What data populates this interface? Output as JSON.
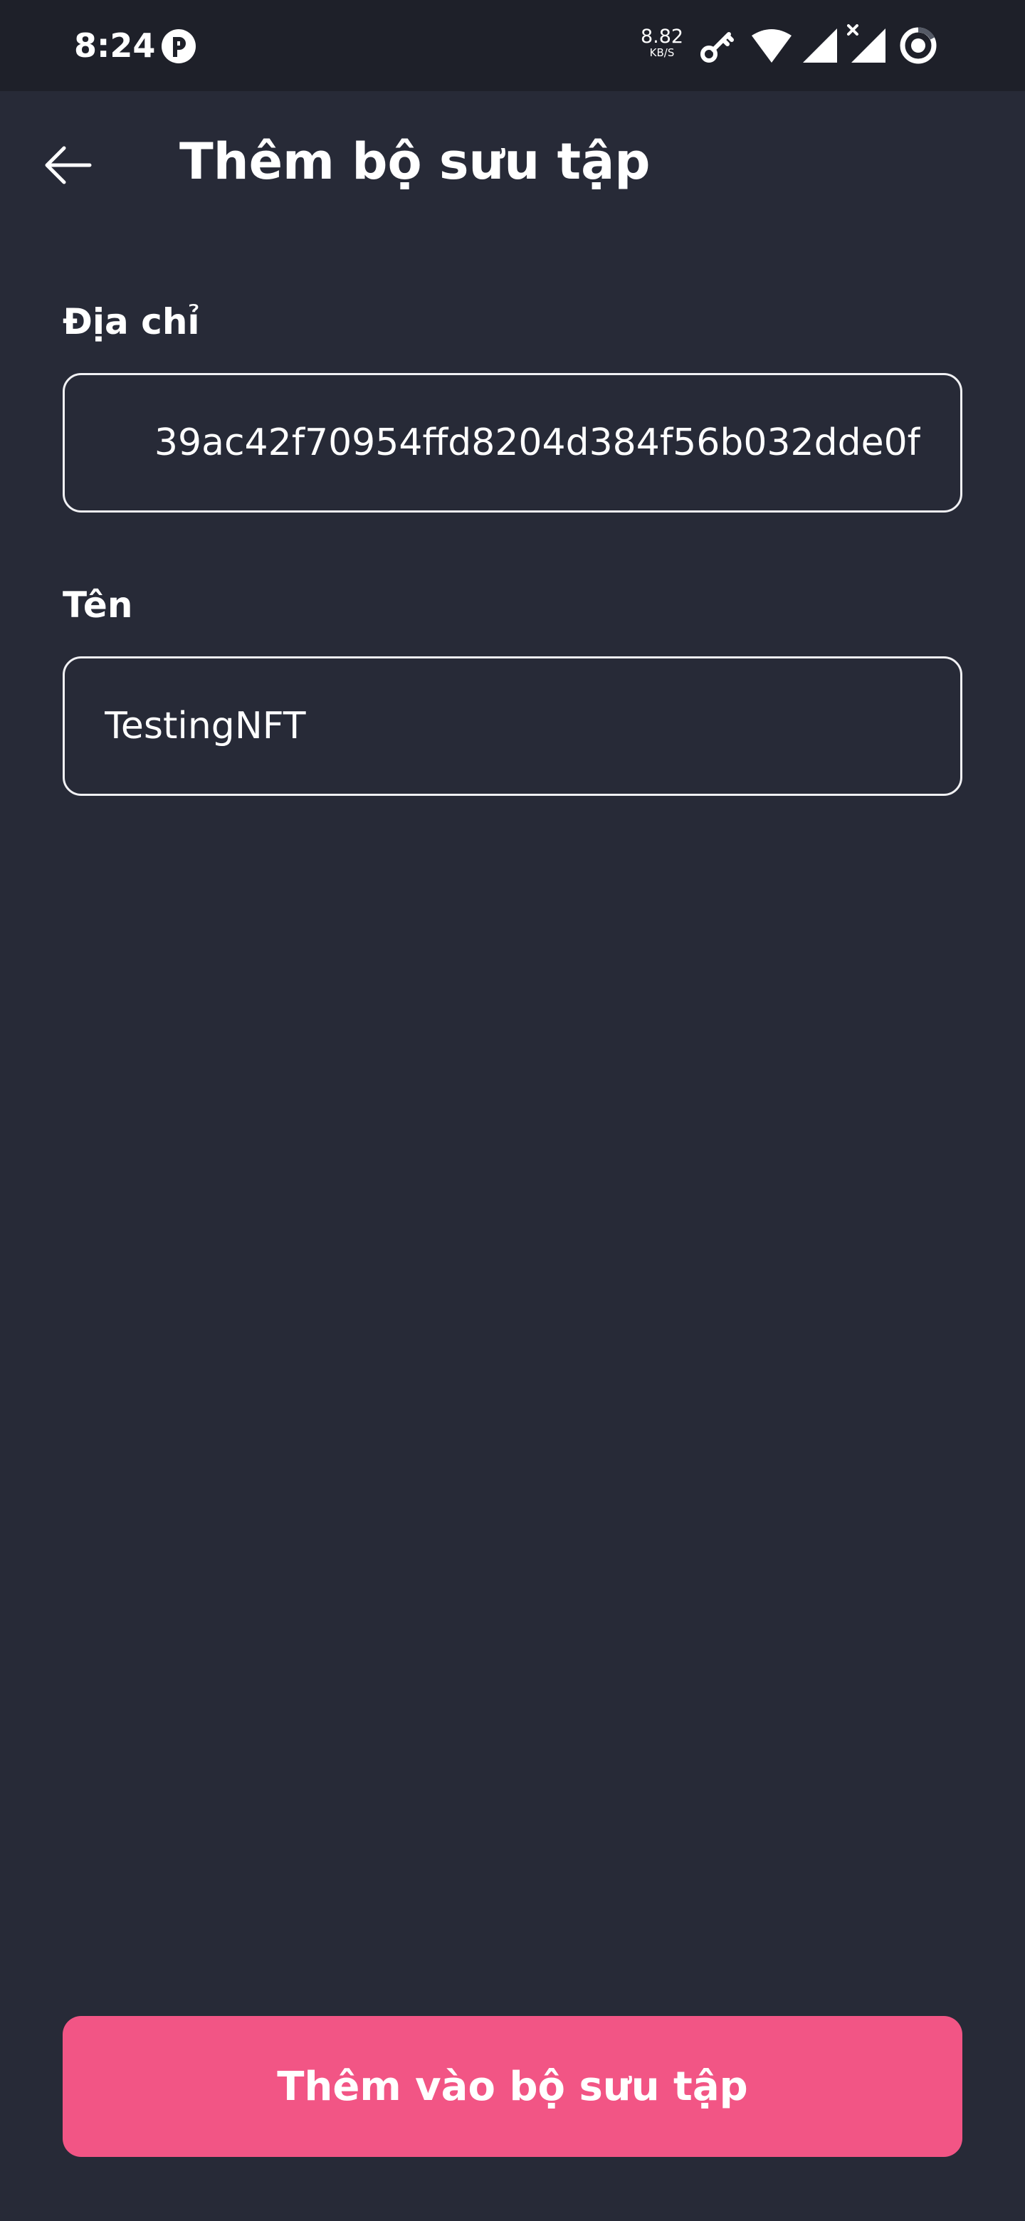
{
  "status_bar": {
    "time": "8:24",
    "net_speed_value": "8.82",
    "net_speed_unit": "KB/S",
    "icons": [
      "app-notification-icon",
      "vpn-key-icon",
      "wifi-icon",
      "cell-signal-icon",
      "cell-signal-no-data-icon",
      "battery-ring-icon"
    ]
  },
  "app_bar": {
    "title": "Thêm bộ sưu tập",
    "back_icon": "arrow-left-icon"
  },
  "form": {
    "address": {
      "label": "Địa chỉ",
      "value": "39ac42f70954ffd8204d384f56b032dde0f"
    },
    "name": {
      "label": "Tên",
      "value": "TestingNFT"
    }
  },
  "primary_action": {
    "label": "Thêm vào bộ sưu tập"
  },
  "colors": {
    "background": "#272a37",
    "status_bar": "#1e2029",
    "field_border": "#f1f1f4",
    "accent": "#f25585"
  }
}
